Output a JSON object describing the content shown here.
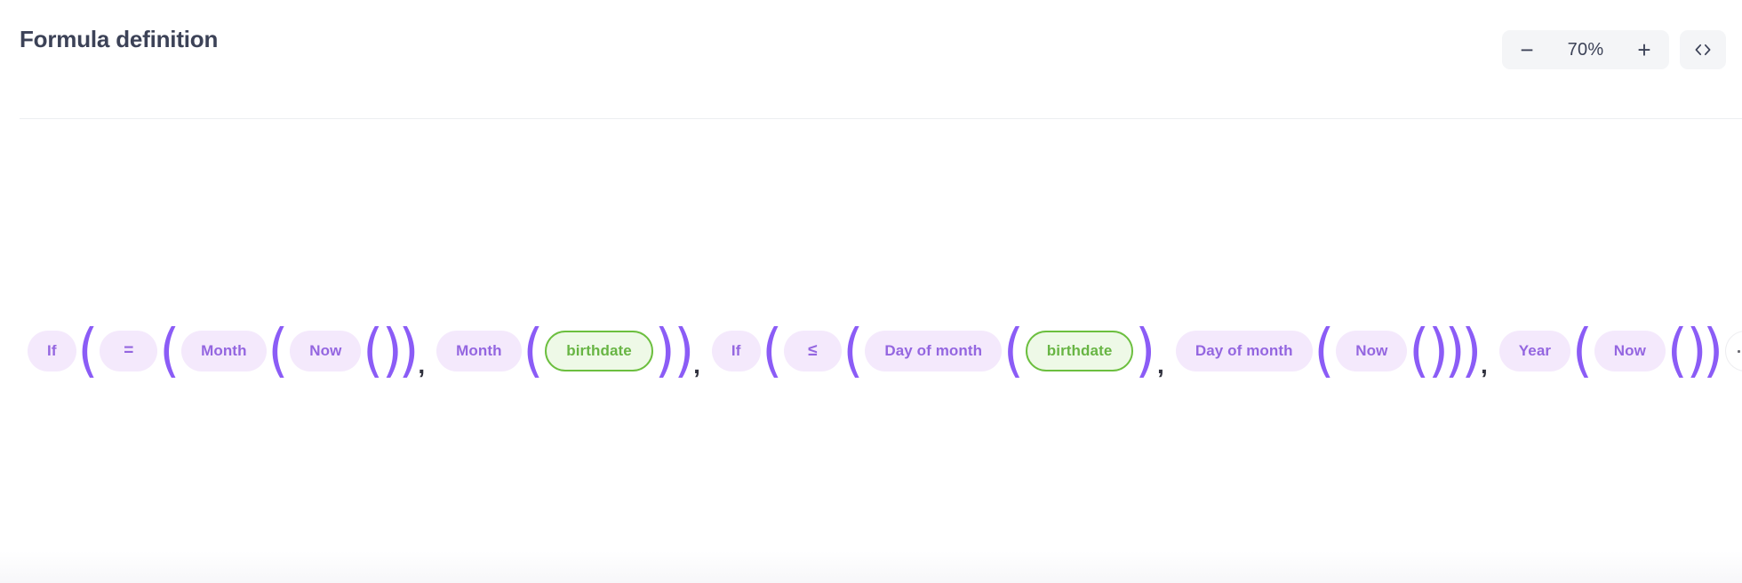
{
  "header": {
    "title": "Formula definition",
    "zoom": {
      "decrease_label": "−",
      "value": "70%",
      "increase_label": "+",
      "code_view_label": "<>"
    }
  },
  "colors": {
    "accent_purple": "#8b5cf6",
    "pill_bg": "#f4e9fc",
    "pill_text": "#9466e0",
    "field_bg": "#eef9e7",
    "field_text": "#68b544",
    "field_border": "#6cbf3f",
    "title_text": "#3c4257",
    "control_bg": "#f4f5f7",
    "divider": "#eceef1"
  },
  "formula": {
    "expression": "If ( = ( Month ( Now ( ) ) , Month ( birthdate ) ) ) , If ( ≤ ( Day of month ( birthdate ) , Day of month ( Now ( ) ) ) ) , Year ( Now ( ) )",
    "tokens": [
      {
        "kind": "pill",
        "text": "If"
      },
      {
        "kind": "paren",
        "text": "("
      },
      {
        "kind": "op",
        "text": "="
      },
      {
        "kind": "paren",
        "text": "("
      },
      {
        "kind": "pill",
        "text": "Month"
      },
      {
        "kind": "paren",
        "text": "("
      },
      {
        "kind": "pill",
        "text": "Now"
      },
      {
        "kind": "paren",
        "text": "("
      },
      {
        "kind": "paren",
        "text": ")"
      },
      {
        "kind": "paren",
        "text": ")"
      },
      {
        "kind": "comma",
        "text": ","
      },
      {
        "kind": "pill",
        "text": "Month"
      },
      {
        "kind": "paren",
        "text": "("
      },
      {
        "kind": "field",
        "text": "birthdate"
      },
      {
        "kind": "paren",
        "text": ")"
      },
      {
        "kind": "paren",
        "text": ")"
      },
      {
        "kind": "comma",
        "text": ","
      },
      {
        "kind": "pill",
        "text": "If"
      },
      {
        "kind": "paren",
        "text": "("
      },
      {
        "kind": "op",
        "text": "≤"
      },
      {
        "kind": "paren",
        "text": "("
      },
      {
        "kind": "pill",
        "text": "Day of month"
      },
      {
        "kind": "paren",
        "text": "("
      },
      {
        "kind": "field",
        "text": "birthdate"
      },
      {
        "kind": "paren",
        "text": ")"
      },
      {
        "kind": "comma",
        "text": ","
      },
      {
        "kind": "pill",
        "text": "Day of month"
      },
      {
        "kind": "paren",
        "text": "("
      },
      {
        "kind": "pill",
        "text": "Now"
      },
      {
        "kind": "paren",
        "text": "("
      },
      {
        "kind": "paren",
        "text": ")"
      },
      {
        "kind": "paren",
        "text": ")"
      },
      {
        "kind": "paren",
        "text": ")"
      },
      {
        "kind": "comma",
        "text": ","
      },
      {
        "kind": "pill",
        "text": "Year"
      },
      {
        "kind": "paren",
        "text": "("
      },
      {
        "kind": "pill",
        "text": "Now"
      },
      {
        "kind": "paren",
        "text": "("
      },
      {
        "kind": "paren",
        "text": ")"
      },
      {
        "kind": "paren",
        "text": ")"
      },
      {
        "kind": "ghost",
        "text": ""
      }
    ]
  }
}
